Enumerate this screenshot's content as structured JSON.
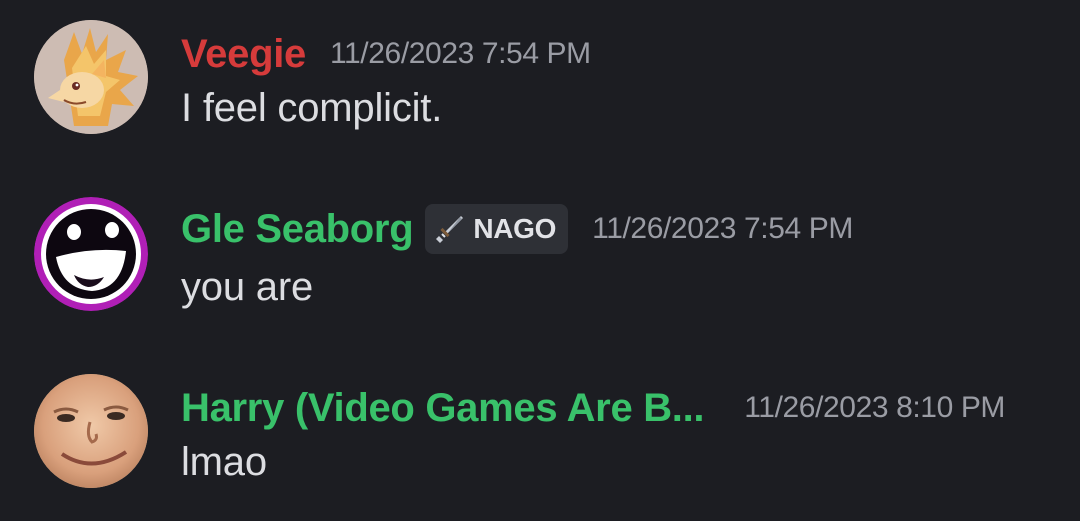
{
  "messages": [
    {
      "username": "Veegie",
      "username_color": "#d63b3b",
      "timestamp": "11/26/2023 7:54 PM",
      "text": "I feel complicit.",
      "avatar_icon": "fox-avatar-icon"
    },
    {
      "username": "Gle Seaborg",
      "username_color": "#39c16a",
      "tag": {
        "label": "NAGO",
        "icon": "sword-icon"
      },
      "timestamp": "11/26/2023 7:54 PM",
      "text": "you are",
      "avatar_icon": "smiley-avatar-icon"
    },
    {
      "username": "Harry (Video Games Are B...",
      "username_color": "#39c16a",
      "timestamp": "11/26/2023 8:10 PM",
      "text": "lmao",
      "avatar_icon": "face-photo-avatar-icon"
    }
  ],
  "colors": {
    "background": "#1c1d22",
    "text": "#dcdde1",
    "timestamp": "#9a9ca4",
    "tag_background": "#2e3036"
  }
}
